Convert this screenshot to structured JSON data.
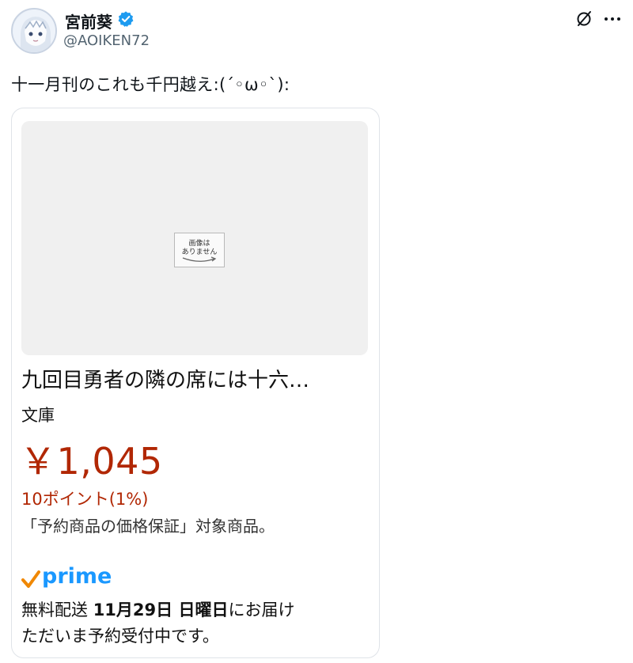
{
  "author": {
    "name": "宮前葵",
    "handle": "@AOIKEN72",
    "verified_color": "#1d9bf0"
  },
  "tweet": {
    "text": "十一月刊のこれも千円越え:(´◦ω◦`):"
  },
  "card": {
    "no_image_line1": "画像は",
    "no_image_line2": "ありません",
    "title": "九回目勇者の隣の席には十六…",
    "format": "文庫",
    "price": "￥1,045",
    "points": "10ポイント(1%)",
    "guarantee": "「予約商品の価格保証」対象商品。",
    "prime": {
      "label": "prime",
      "check_color": "#f08804",
      "text_color": "#1a98ff"
    },
    "delivery": {
      "prefix": "無料配送 ",
      "date": "11月29日 日曜日",
      "suffix": "にお届け",
      "line2": "ただいま予約受付中です。"
    },
    "price_color": "#b12704"
  },
  "icons": {
    "top_right_1": "slash-circle-icon",
    "top_right_2": "more-icon"
  }
}
